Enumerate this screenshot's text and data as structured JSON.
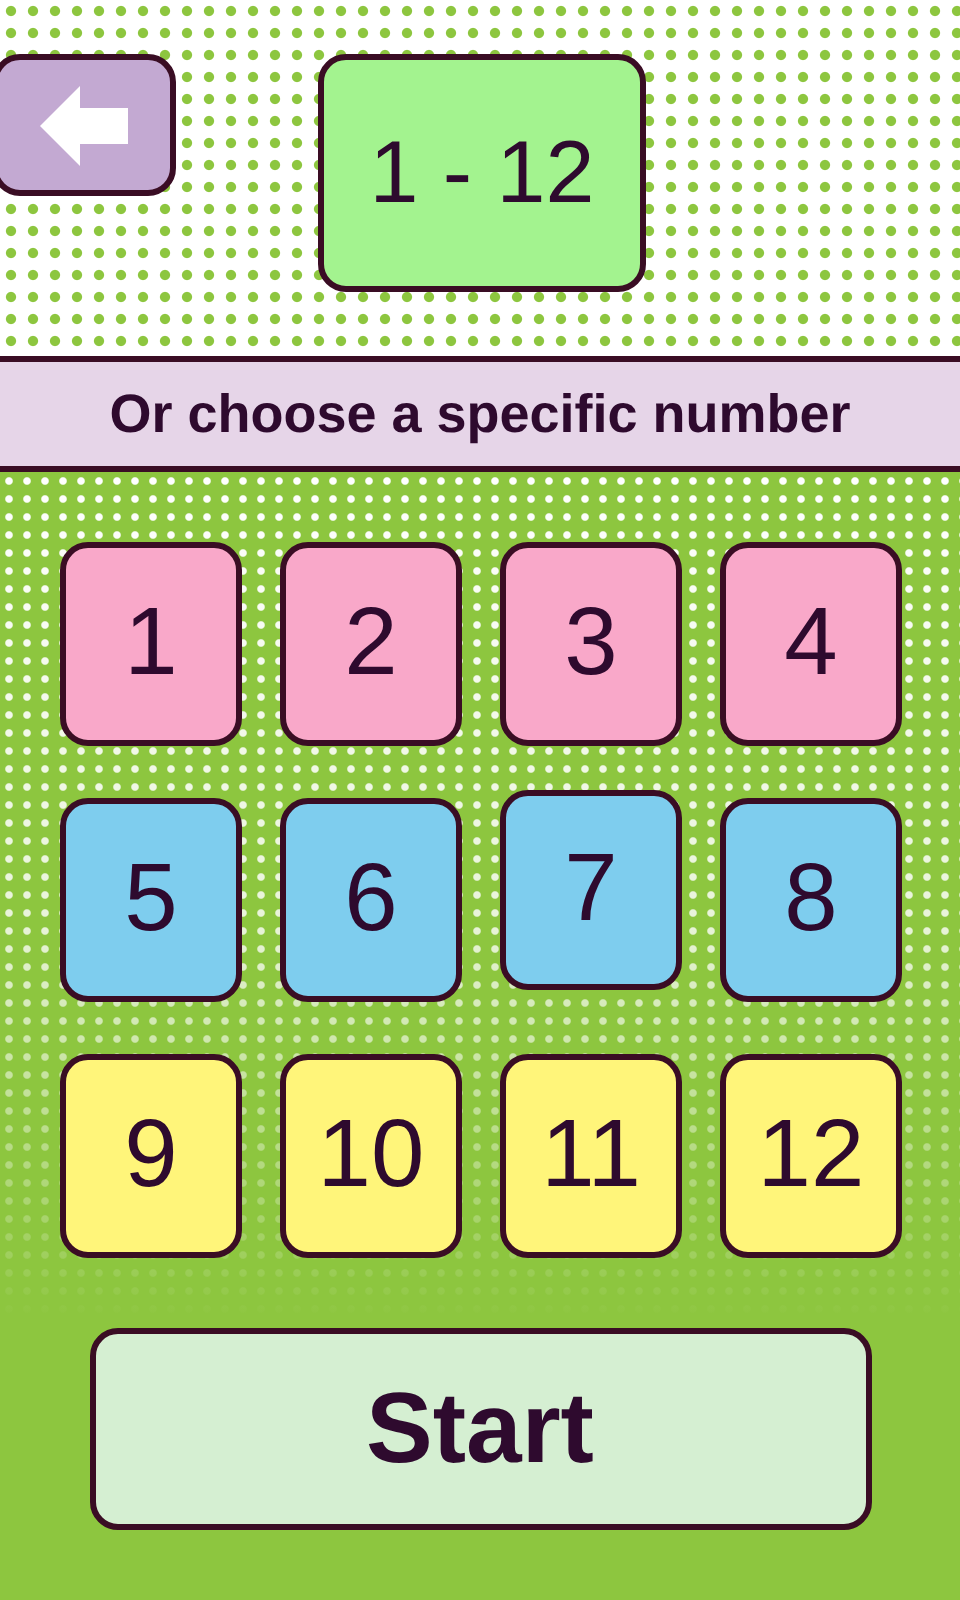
{
  "back_button": {
    "kind": "back"
  },
  "range_button": {
    "label": "1 - 12"
  },
  "prompt": "Or choose a specific number",
  "numbers": [
    {
      "label": "1",
      "color": "#f9a8c9",
      "selected": false
    },
    {
      "label": "2",
      "color": "#f9a8c9",
      "selected": false
    },
    {
      "label": "3",
      "color": "#f9a8c9",
      "selected": false
    },
    {
      "label": "4",
      "color": "#f9a8c9",
      "selected": false
    },
    {
      "label": "5",
      "color": "#7ecdee",
      "selected": false
    },
    {
      "label": "6",
      "color": "#7ecdee",
      "selected": false
    },
    {
      "label": "7",
      "color": "#7ecdee",
      "selected": true
    },
    {
      "label": "8",
      "color": "#7ecdee",
      "selected": false
    },
    {
      "label": "9",
      "color": "#fff57a",
      "selected": false
    },
    {
      "label": "10",
      "color": "#fff57a",
      "selected": false
    },
    {
      "label": "11",
      "color": "#fff57a",
      "selected": false
    },
    {
      "label": "12",
      "color": "#fff57a",
      "selected": false
    }
  ],
  "start_button": {
    "label": "Start"
  }
}
